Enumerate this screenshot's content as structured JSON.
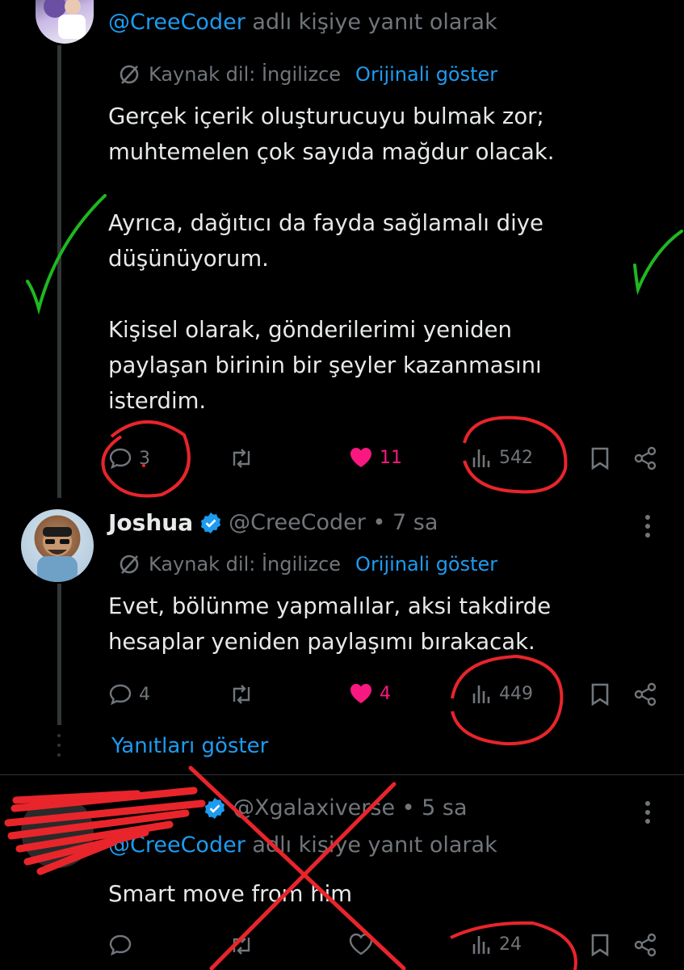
{
  "colors": {
    "accent": "#1d9bf0",
    "like": "#f91880",
    "muted": "#71767b",
    "text": "#e7e9ea",
    "annotation_red": "#e8252b",
    "annotation_green": "#1fb81f"
  },
  "tweet1": {
    "reply_to": {
      "handle": "@CreeCoder",
      "suffix": "adlı kişiye yanıt olarak"
    },
    "translation": {
      "label": "Kaynak dil: İngilizce",
      "show_original": "Orijinali göster"
    },
    "text": "Gerçek içerik oluşturucuyu bulmak zor;\nmuhtemelen çok sayıda mağdur olacak.\n\nAyrıca, dağıtıcı da fayda sağlamalı diye\ndüşünüyorum.\n\nKişisel olarak, gönderilerimi yeniden\npaylaşan birinin bir şeyler kazanmasını\nisterdim.",
    "stats": {
      "replies": "3",
      "likes": "11",
      "views": "542"
    }
  },
  "tweet2": {
    "name": "Joshua",
    "meta": "@CreeCoder • 7 sa",
    "translation": {
      "label": "Kaynak dil: İngilizce",
      "show_original": "Orijinali göster"
    },
    "text": "Evet, bölünme yapmalılar, aksi takdirde\nhesaplar yeniden paylaşımı bırakacak.",
    "stats": {
      "replies": "4",
      "likes": "4",
      "views": "449"
    }
  },
  "show_replies": "Yanıtları göster",
  "tweet3": {
    "meta": "@Xgalaxiverse • 5 sa",
    "reply_to": {
      "handle": "@CreeCoder",
      "suffix": "adlı kişiye yanıt olarak"
    },
    "text": "Smart move from him",
    "stats": {
      "views": "24"
    }
  },
  "icons": {
    "translate": "translate-icon",
    "reply": "reply-icon",
    "retweet": "retweet-icon",
    "like": "like-icon",
    "views": "views-icon",
    "bookmark": "bookmark-icon",
    "share": "share-icon",
    "more": "more-icon",
    "verified": "verified-badge-icon"
  }
}
